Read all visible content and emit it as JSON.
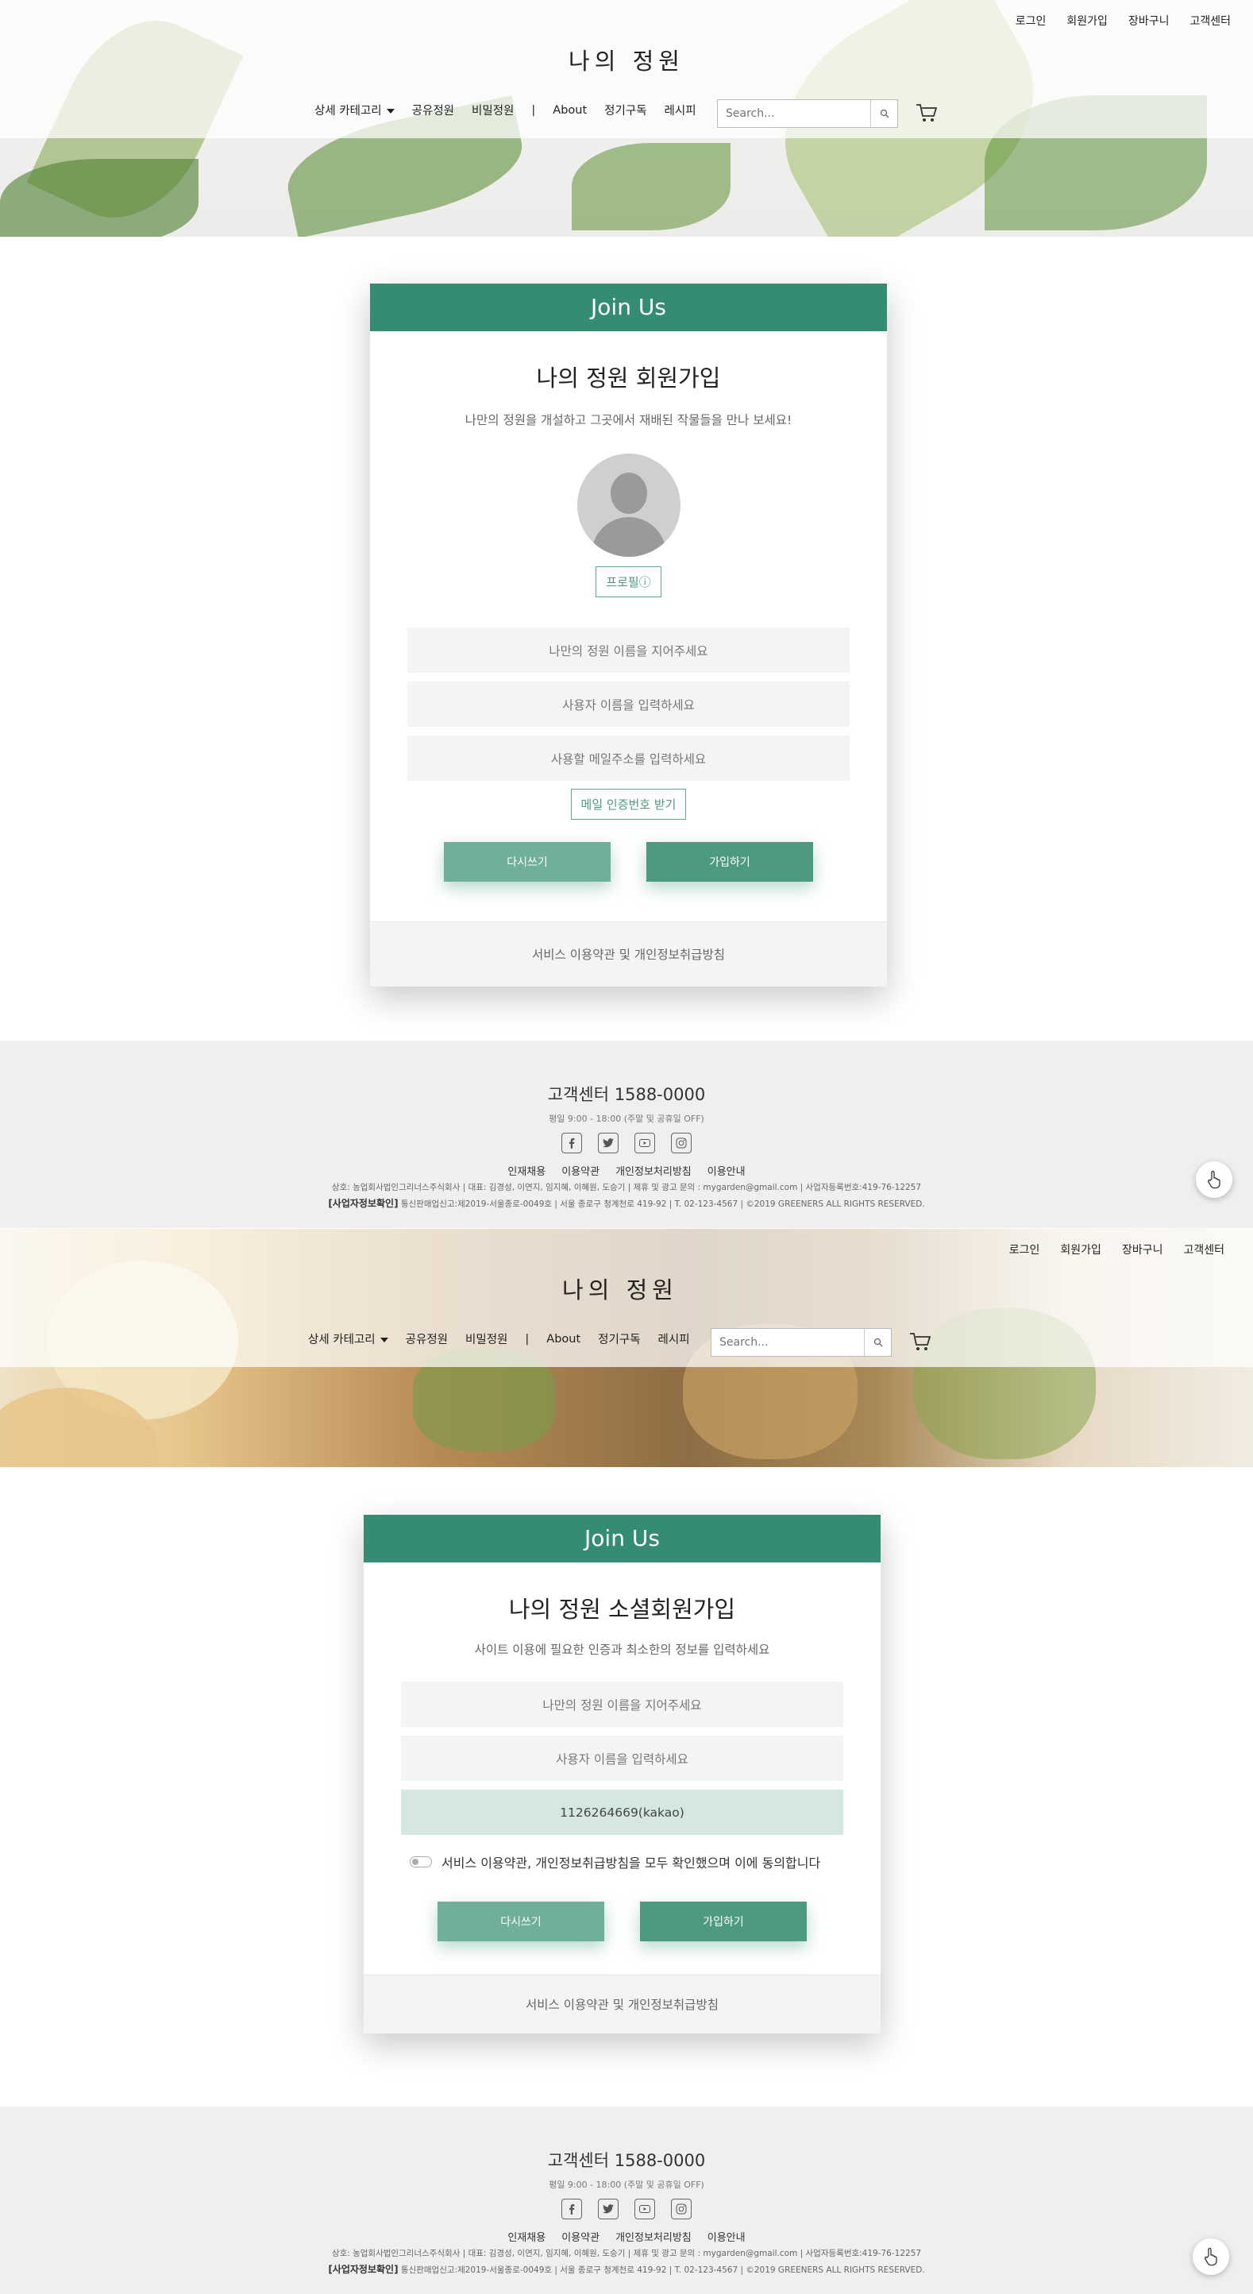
{
  "top_links": [
    "로그인",
    "회원가입",
    "장바구니",
    "고객센터"
  ],
  "logo": "나의 정원",
  "nav": {
    "items": [
      "상세 카테고리",
      "공유정원",
      "비밀정원",
      "|",
      "About",
      "정기구독",
      "레시피"
    ],
    "search_placeholder": "Search..."
  },
  "signup": {
    "header": "Join Us",
    "title": "나의 정원 회원가입",
    "subtitle": "나만의 정원을 개설하고 그곳에서 재배된 작물들을 만나 보세요!",
    "profile_button": "프로필ⓘ",
    "fields": [
      {
        "placeholder": "나만의 정원 이름을 지어주세요"
      },
      {
        "placeholder": "사용자 이름을 입력하세요"
      },
      {
        "placeholder": "사용할 메일주소를 입력하세요"
      }
    ],
    "verify_button": "메일 인증번호 받기",
    "reset_button": "다시쓰기",
    "join_button": "가입하기",
    "footer_link": "서비스 이용약관 및 개인정보취급방침"
  },
  "social_signup": {
    "header": "Join Us",
    "title": "나의 정원 소셜회원가입",
    "subtitle": "사이트 이용에 필요한 인증과 최소한의 정보를 입력하세요",
    "fields": [
      {
        "placeholder": "나만의 정원 이름을 지어주세요"
      },
      {
        "placeholder": "사용자 이름을 입력하세요"
      },
      {
        "value": "1126264669(kakao)"
      }
    ],
    "consent": "서비스 이용약관, 개인정보취급방침을 모두 확인했으며 이에 동의합니다",
    "reset_button": "다시쓰기",
    "join_button": "가입하기",
    "footer_link": "서비스 이용약관 및 개인정보취급방침"
  },
  "footer": {
    "phone": "고객센터 1588-0000",
    "hours": "평일 9:00 - 18:00 (주말 및 공휴일 OFF)",
    "socials": [
      "facebook-icon",
      "twitter-icon",
      "youtube-icon",
      "instagram-icon"
    ],
    "links": [
      "인재채용",
      "이용약관",
      "개인정보처리방침",
      "이용안내"
    ],
    "info1": "상호: 농업회사법인그리너스주식회사 | 대표: 김경성, 이연지, 임지혜, 이혜원, 도승기 | 제휴 및 광고 문의 : mygarden@gmail.com | 사업자등록번호:419-76-12257",
    "info2_label": "[사업자정보확인]",
    "info2": "통신판매업신고:제2019-서울종로-0049호 | 서울 종로구 청계천로 419-92 | T. 02-123-4567 | ©2019 GREENERS ALL RIGHTS RESERVED."
  },
  "colors": {
    "accent": "#348c73",
    "accent_light": "#6faf9b",
    "filled_field": "#d4e8e1"
  }
}
